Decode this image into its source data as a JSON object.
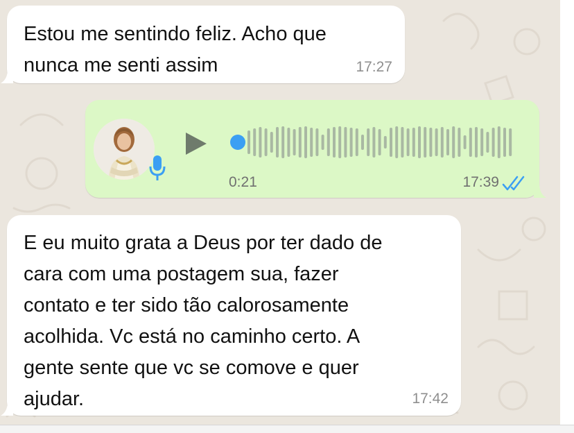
{
  "messages": [
    {
      "direction": "incoming",
      "lines": [
        "Estou me sentindo feliz. Acho que",
        "nunca me senti assim"
      ],
      "time": "17:27"
    },
    {
      "direction": "outgoing",
      "type": "voice",
      "duration": "0:21",
      "time": "17:39",
      "status_icon": "double-check-read-icon",
      "playback_progress": 0
    },
    {
      "direction": "incoming",
      "lines": [
        "E eu muito grata a Deus por ter dado de",
        "cara com uma postagem sua, fazer",
        "contato e ter sido tão calorosamente",
        "acolhida. Vc está no caminho certo. A",
        "gente sente que vc se comove e quer",
        "ajudar."
      ],
      "time": "17:42"
    }
  ],
  "colors": {
    "incoming_bubble": "#ffffff",
    "outgoing_bubble": "#dcf8c6",
    "wallpaper": "#ebe6de",
    "play_icon": "#6f7b6c",
    "mic_icon": "#3b9ff3",
    "playhead": "#3b9ff3",
    "waveform": "#a9b8a3",
    "read_ticks": "#3b9ff3"
  }
}
